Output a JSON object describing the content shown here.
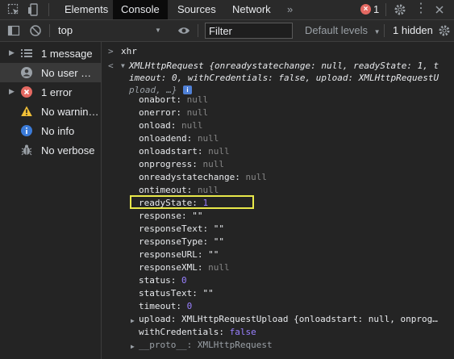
{
  "topbar": {
    "tabs": [
      "Elements",
      "Console",
      "Sources",
      "Network"
    ],
    "more": "»",
    "error_count": "1"
  },
  "toolbar": {
    "context": "top",
    "filter_placeholder": "Filter",
    "levels": "Default levels",
    "hidden": "1 hidden"
  },
  "sidebar": {
    "items": [
      {
        "label": "1 message",
        "icon": "list-icon"
      },
      {
        "label": "No user me...",
        "icon": "user-icon"
      },
      {
        "label": "1 error",
        "icon": "error-icon"
      },
      {
        "label": "No warnings",
        "icon": "warning-icon"
      },
      {
        "label": "No info",
        "icon": "info-icon"
      },
      {
        "label": "No verbose",
        "icon": "bug-icon"
      }
    ]
  },
  "console": {
    "input": "xhr",
    "summary1": "XMLHttpRequest {onreadystatechange: null, readyState: 1, t",
    "summary2": "imeout: 0, withCredentials: false, upload: XMLHttpRequestU",
    "summary3": "pload, …}",
    "props": [
      {
        "k": "onabort",
        "v": "null",
        "t": "null"
      },
      {
        "k": "onerror",
        "v": "null",
        "t": "null"
      },
      {
        "k": "onload",
        "v": "null",
        "t": "null"
      },
      {
        "k": "onloadend",
        "v": "null",
        "t": "null"
      },
      {
        "k": "onloadstart",
        "v": "null",
        "t": "null"
      },
      {
        "k": "onprogress",
        "v": "null",
        "t": "null"
      },
      {
        "k": "onreadystatechange",
        "v": "null",
        "t": "null"
      },
      {
        "k": "ontimeout",
        "v": "null",
        "t": "null"
      },
      {
        "k": "readyState",
        "v": "1",
        "t": "num"
      },
      {
        "k": "response",
        "v": "\"\"",
        "t": "str"
      },
      {
        "k": "responseText",
        "v": "\"\"",
        "t": "str"
      },
      {
        "k": "responseType",
        "v": "\"\"",
        "t": "str"
      },
      {
        "k": "responseURL",
        "v": "\"\"",
        "t": "str"
      },
      {
        "k": "responseXML",
        "v": "null",
        "t": "null"
      },
      {
        "k": "status",
        "v": "0",
        "t": "num"
      },
      {
        "k": "statusText",
        "v": "\"\"",
        "t": "str"
      },
      {
        "k": "timeout",
        "v": "0",
        "t": "num"
      }
    ],
    "upload_key": "upload",
    "upload_val": "XMLHttpRequestUpload {onloadstart: null, onprog…",
    "withcred_key": "withCredentials",
    "withcred_val": "false",
    "proto_key": "__proto__",
    "proto_val": "XMLHttpRequest"
  }
}
